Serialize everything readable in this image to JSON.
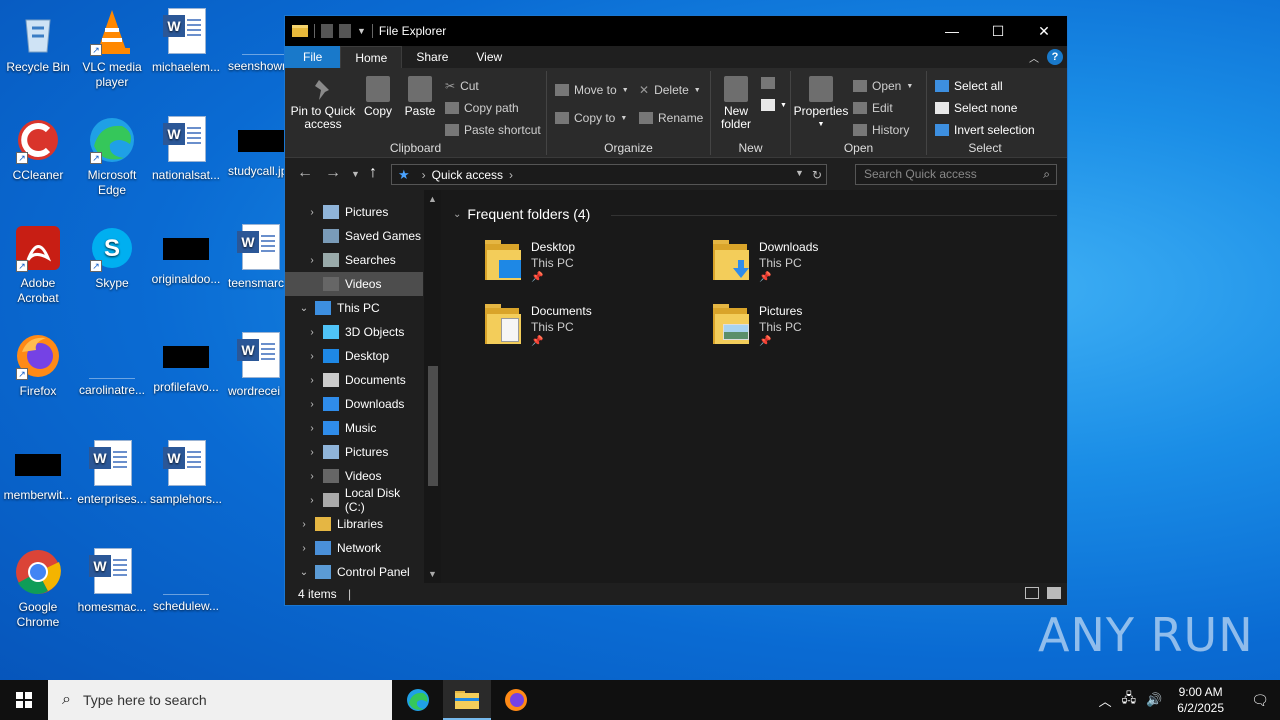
{
  "desktop": {
    "icons": [
      {
        "label": "Recycle Bin"
      },
      {
        "label": "VLC media player"
      },
      {
        "label": "michaelem..."
      },
      {
        "label": "seenshowm"
      },
      {
        "label": "CCleaner"
      },
      {
        "label": "Microsoft Edge"
      },
      {
        "label": "nationalsat..."
      },
      {
        "label": "studycall.jp"
      },
      {
        "label": "Adobe Acrobat"
      },
      {
        "label": "Skype"
      },
      {
        "label": "originaldoo..."
      },
      {
        "label": "teensmarc"
      },
      {
        "label": "Firefox"
      },
      {
        "label": "carolinatre..."
      },
      {
        "label": "profilefavo..."
      },
      {
        "label": "wordrecei"
      },
      {
        "label": "memberwit..."
      },
      {
        "label": "enterprises..."
      },
      {
        "label": "samplehors..."
      },
      {
        "label": "Google Chrome"
      },
      {
        "label": "homesmac..."
      },
      {
        "label": "schedulew..."
      }
    ],
    "watermark": "ANY RUN"
  },
  "window": {
    "title": "File Explorer",
    "tabs": {
      "file": "File",
      "home": "Home",
      "share": "Share",
      "view": "View"
    },
    "ribbon": {
      "clipboard": {
        "label": "Clipboard",
        "pin": "Pin to Quick access",
        "copy": "Copy",
        "paste": "Paste",
        "cut": "Cut",
        "copy_path": "Copy path",
        "paste_shortcut": "Paste shortcut"
      },
      "organize": {
        "label": "Organize",
        "move_to": "Move to",
        "copy_to": "Copy to",
        "delete": "Delete",
        "rename": "Rename"
      },
      "new": {
        "label": "New",
        "new_folder": "New folder"
      },
      "open": {
        "label": "Open",
        "properties": "Properties",
        "open": "Open",
        "edit": "Edit",
        "history": "History"
      },
      "select": {
        "label": "Select",
        "select_all": "Select all",
        "select_none": "Select none",
        "invert": "Invert selection"
      }
    },
    "address": {
      "path": "Quick access",
      "search_placeholder": "Search Quick access"
    },
    "nav": [
      {
        "label": "Pictures"
      },
      {
        "label": "Saved Games"
      },
      {
        "label": "Searches"
      },
      {
        "label": "Videos"
      },
      {
        "label": "This PC"
      },
      {
        "label": "3D Objects"
      },
      {
        "label": "Desktop"
      },
      {
        "label": "Documents"
      },
      {
        "label": "Downloads"
      },
      {
        "label": "Music"
      },
      {
        "label": "Pictures"
      },
      {
        "label": "Videos"
      },
      {
        "label": "Local Disk (C:)"
      },
      {
        "label": "Libraries"
      },
      {
        "label": "Network"
      },
      {
        "label": "Control Panel"
      }
    ],
    "frequent_header": "Frequent folders (4)",
    "folders": [
      {
        "name": "Desktop",
        "location": "This PC"
      },
      {
        "name": "Downloads",
        "location": "This PC"
      },
      {
        "name": "Documents",
        "location": "This PC"
      },
      {
        "name": "Pictures",
        "location": "This PC"
      }
    ],
    "status": {
      "count": "4 items"
    }
  },
  "taskbar": {
    "search_placeholder": "Type here to search",
    "time": "9:00 AM",
    "date": "6/2/2025"
  }
}
